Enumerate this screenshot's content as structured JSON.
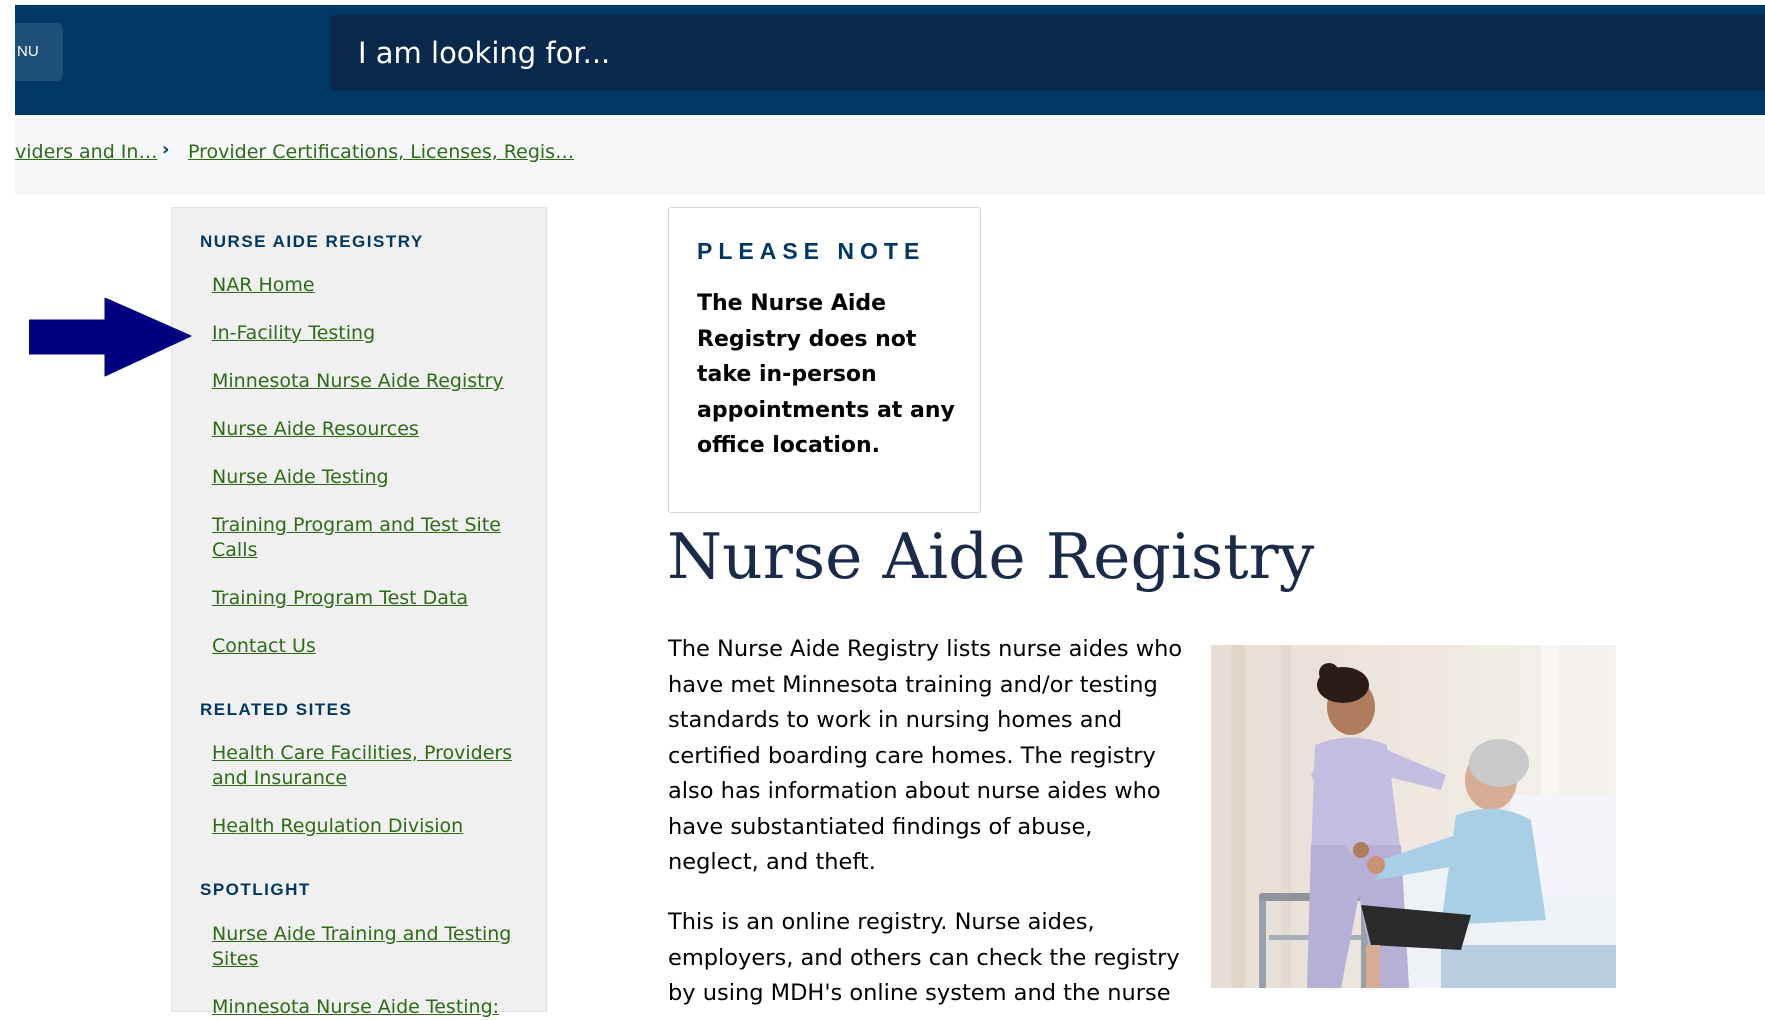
{
  "header": {
    "menu_label": "NU",
    "search_placeholder": "I am looking for..."
  },
  "breadcrumb": {
    "items": [
      "viders and In…",
      "Provider Certifications, Licenses, Regis…"
    ],
    "separator": "›"
  },
  "sidebar": {
    "sections": [
      {
        "heading": "NURSE AIDE REGISTRY",
        "links": [
          "NAR Home",
          "In-Facility Testing",
          "Minnesota Nurse Aide Registry",
          "Nurse Aide Resources",
          "Nurse Aide Testing",
          "Training Program and Test Site Calls",
          "Training Program Test Data",
          "Contact Us"
        ]
      },
      {
        "heading": "RELATED SITES",
        "links": [
          "Health Care Facilities, Providers and Insurance",
          "Health Regulation Division"
        ]
      },
      {
        "heading": "SPOTLIGHT",
        "links": [
          "Nurse Aide Training and Testing Sites",
          "Minnesota Nurse Aide Testing:"
        ]
      }
    ]
  },
  "note": {
    "title": "PLEASE NOTE",
    "body": "The Nurse Aide Registry does not take in-person appointments at any office location."
  },
  "main": {
    "title": "Nurse Aide Registry",
    "paragraphs": [
      "The Nurse Aide Registry lists nurse aides who have met Minnesota training and/or testing standards to work in nursing homes and certified boarding care homes. The registry also has information about nurse aides who have substantiated findings of abuse, neglect, and theft.",
      "This is an online registry. Nurse aides, employers, and others can check the registry by using MDH's online system and the nurse"
    ]
  },
  "colors": {
    "header_bg": "#003865",
    "search_bg": "#08294b",
    "link_green": "#2e6b16",
    "heading_navy": "#003865",
    "arrow_navy": "#000080"
  },
  "icons": {
    "pointer_arrow": "arrow-right-icon",
    "breadcrumb_separator": "chevron-right-icon"
  }
}
